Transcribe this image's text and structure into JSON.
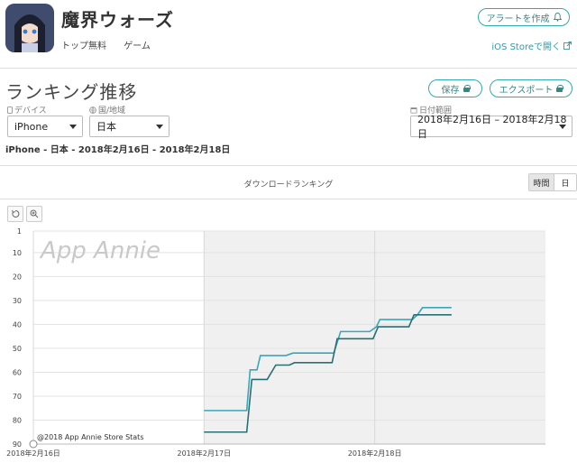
{
  "app": {
    "title": "魔界ウォーズ",
    "category": "トップ無料",
    "genre": "ゲーム",
    "alert_button": "アラートを作成",
    "store_link": "iOS Storeで開く"
  },
  "section": {
    "title": "ランキング推移",
    "save_button": "保存",
    "export_button": "エクスポート"
  },
  "filters": {
    "device_label": "デバイス",
    "device_value": "iPhone",
    "country_label": "国/地域",
    "country_value": "日本",
    "date_label": "日付範囲",
    "date_value": "2018年2月16日 – 2018年2月18日"
  },
  "summary": "iPhone - 日本 - 2018年2月16日 - 2018年2月18日",
  "chart_header": {
    "label": "ダウンロードランキング",
    "granularity": [
      "時間",
      "日"
    ],
    "active": "時間"
  },
  "toolbar": {
    "reset_icon": "reset-icon",
    "zoom_icon": "zoom-icon"
  },
  "colors": {
    "accent": "#33aaaa",
    "series_light": "#3aa6b9",
    "series_dark": "#2a6f73",
    "shade": "#f0f0f0"
  },
  "chart_data": {
    "type": "line",
    "watermark": "App Annie",
    "credit": "@2018 App Annie Store Stats",
    "y_ticks": [
      1,
      10,
      20,
      30,
      40,
      50,
      60,
      70,
      80,
      90
    ],
    "y_inverted": true,
    "ylim": [
      1,
      90
    ],
    "x_ticks": [
      "2018年2月16日",
      "2018年2月17日",
      "2018年2月18日"
    ],
    "xlim": [
      0,
      3
    ],
    "grid": true,
    "series": [
      {
        "color": "#3aa6b9",
        "points": [
          [
            1.0,
            76
          ],
          [
            1.25,
            76
          ],
          [
            1.27,
            59
          ],
          [
            1.31,
            59
          ],
          [
            1.33,
            53
          ],
          [
            1.48,
            53
          ],
          [
            1.52,
            52
          ],
          [
            1.76,
            52
          ],
          [
            1.8,
            43
          ],
          [
            1.97,
            43
          ],
          [
            2.01,
            41
          ],
          [
            2.03,
            38
          ],
          [
            2.22,
            38
          ],
          [
            2.25,
            36
          ],
          [
            2.28,
            33
          ],
          [
            2.45,
            33
          ]
        ]
      },
      {
        "color": "#2a6f73",
        "points": [
          [
            1.0,
            85
          ],
          [
            1.25,
            85
          ],
          [
            1.28,
            63
          ],
          [
            1.37,
            63
          ],
          [
            1.42,
            57
          ],
          [
            1.5,
            57
          ],
          [
            1.53,
            56
          ],
          [
            1.75,
            56
          ],
          [
            1.78,
            46
          ],
          [
            1.99,
            46
          ],
          [
            2.02,
            41
          ],
          [
            2.2,
            41
          ],
          [
            2.23,
            36
          ],
          [
            2.45,
            36
          ]
        ]
      }
    ]
  }
}
